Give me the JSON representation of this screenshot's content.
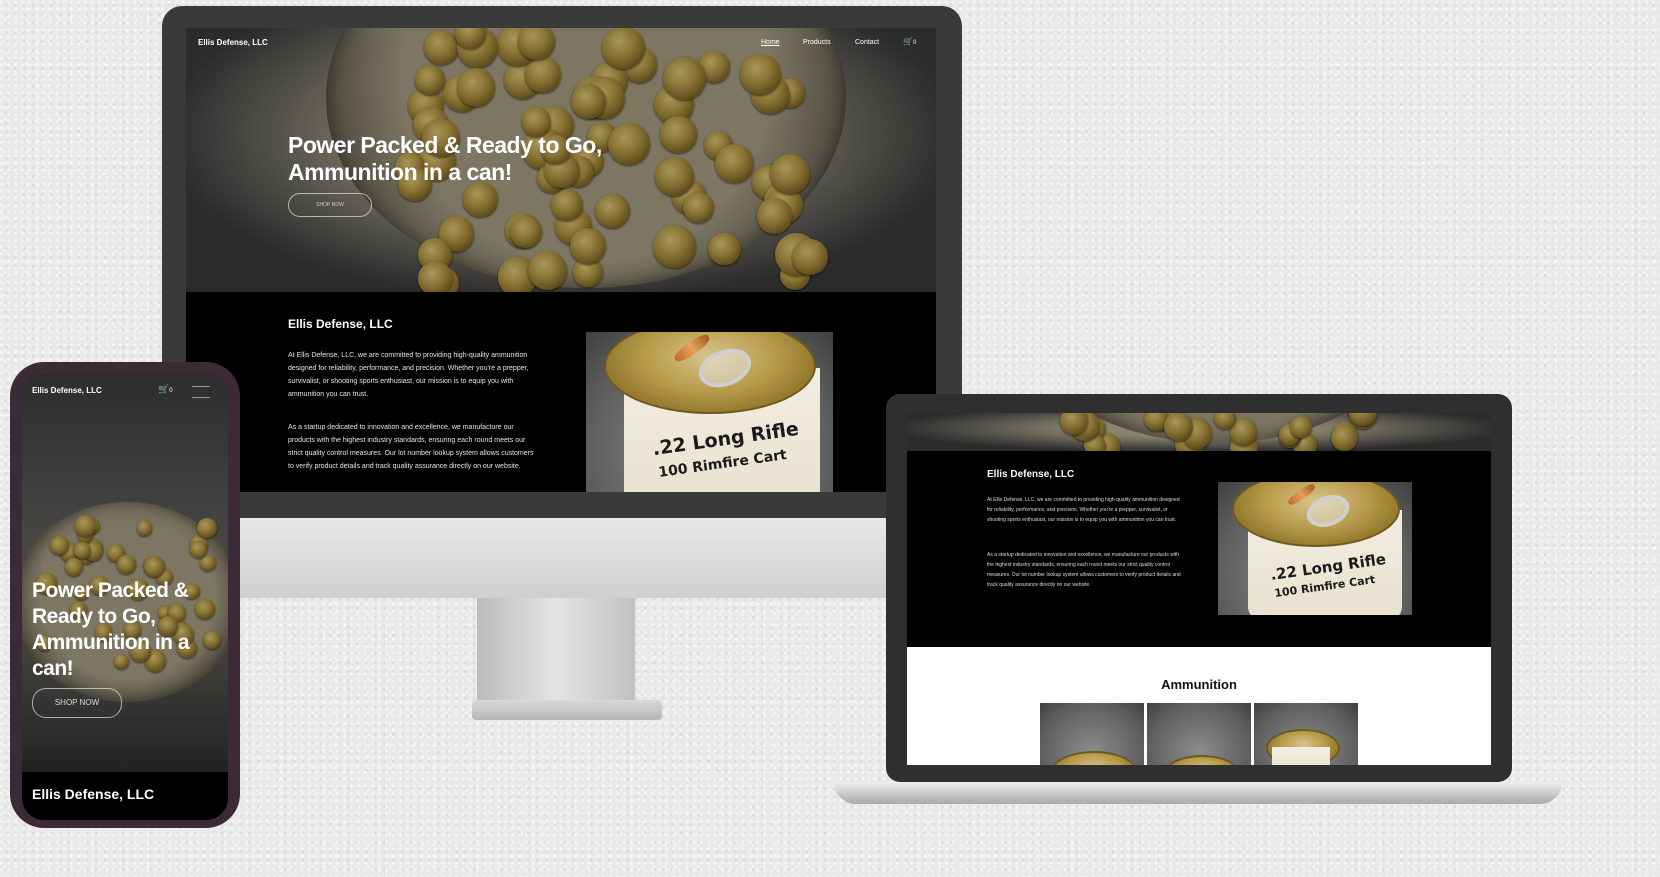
{
  "site": {
    "brand": "Ellis Defense, LLC",
    "nav": [
      "Home",
      "Products",
      "Contact"
    ],
    "cart_count": "0"
  },
  "hero": {
    "title_line1": "Power Packed & Ready to Go,",
    "title_line2": "Ammunition in a can!",
    "button": "SHOP NOW"
  },
  "about": {
    "heading": "Ellis Defense, LLC",
    "p1": "At Ellis Defense, LLC, we are committed to providing high-quality ammunition designed for reliability, performance, and precision. Whether you're a prepper, survivalist, or shooting sports enthusiast, our mission is to equip you with ammunition you can trust.",
    "p2": "As a startup dedicated to innovation and excellence, we manufacture our products with the highest industry standards, ensuring each round meets our strict quality control measures. Our lot number lookup system allows customers to verify product details and track quality assurance directly on our website.",
    "can_line1": ".22 Long Rifle",
    "can_line2": "100 Rimfire Cart"
  },
  "laptop_section": {
    "heading": "Ammunition"
  },
  "phone": {
    "hero_title": "Power Packed & Ready to Go, Ammunition in a can!",
    "footer_brand": "Ellis Defense, LLC"
  },
  "colors": {
    "background": "#e9e9e9",
    "dark": "#000000",
    "frame": "#3a3a3a",
    "brass": "#b69a46"
  }
}
